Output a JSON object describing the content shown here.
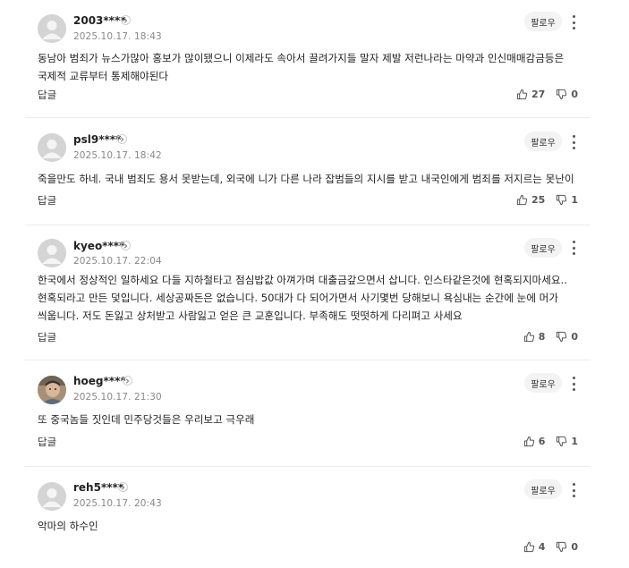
{
  "follow_label": "팔로우",
  "reply_label": "답글",
  "comments": [
    {
      "username": "2003****",
      "timestamp": "2025.10.17. 18:43",
      "text": "동남아 범죄가 뉴스가많아 홍보가 많이됐으니 이제라도 속아서 끌려가지들 말자 제발 저런나라는 마약과 인신매매감금등은 국제적 교류부터 통제해야된다",
      "likes": "27",
      "dislikes": "0",
      "avatar": "default"
    },
    {
      "username": "psl9****",
      "timestamp": "2025.10.17. 18:42",
      "text": "죽을만도 하네. 국내 범죄도 용서 못받는데, 외국에 니가 다른 나라 잡범들의 지시를 받고 내국인에게 범죄를 저지르는 못난이 .",
      "likes": "25",
      "dislikes": "1",
      "avatar": "default"
    },
    {
      "username": "kyeo****",
      "timestamp": "2025.10.17. 22:04",
      "text": "한국에서 정상적인 일하세요 다들 지하철타고 점심밥값 아껴가며 대출금갚으면서 삽니다. 인스타같은것에 현혹되지마세요..현혹되라고 만든 덫입니다. 세상공짜돈은 없습니다. 50대가 다 되어가면서 사기몇번 당해보니 욕심내는 순간에 눈에 머가 씌웁니다. 저도 돈잃고 상처받고 사람잃고 얻은 큰 교훈입니다. 부족해도 떳떳하게 다리펴고 사세요",
      "likes": "8",
      "dislikes": "0",
      "avatar": "default"
    },
    {
      "username": "hoeg****",
      "timestamp": "2025.10.17. 21:30",
      "text": "또 중국놈들 짓인데 민주당것들은 우리보고 극우래",
      "likes": "6",
      "dislikes": "1",
      "avatar": "photo"
    },
    {
      "username": "reh5****",
      "timestamp": "2025.10.17. 20:43",
      "text": "악마의 하수인",
      "likes": "4",
      "dislikes": "0",
      "avatar": "default"
    }
  ]
}
